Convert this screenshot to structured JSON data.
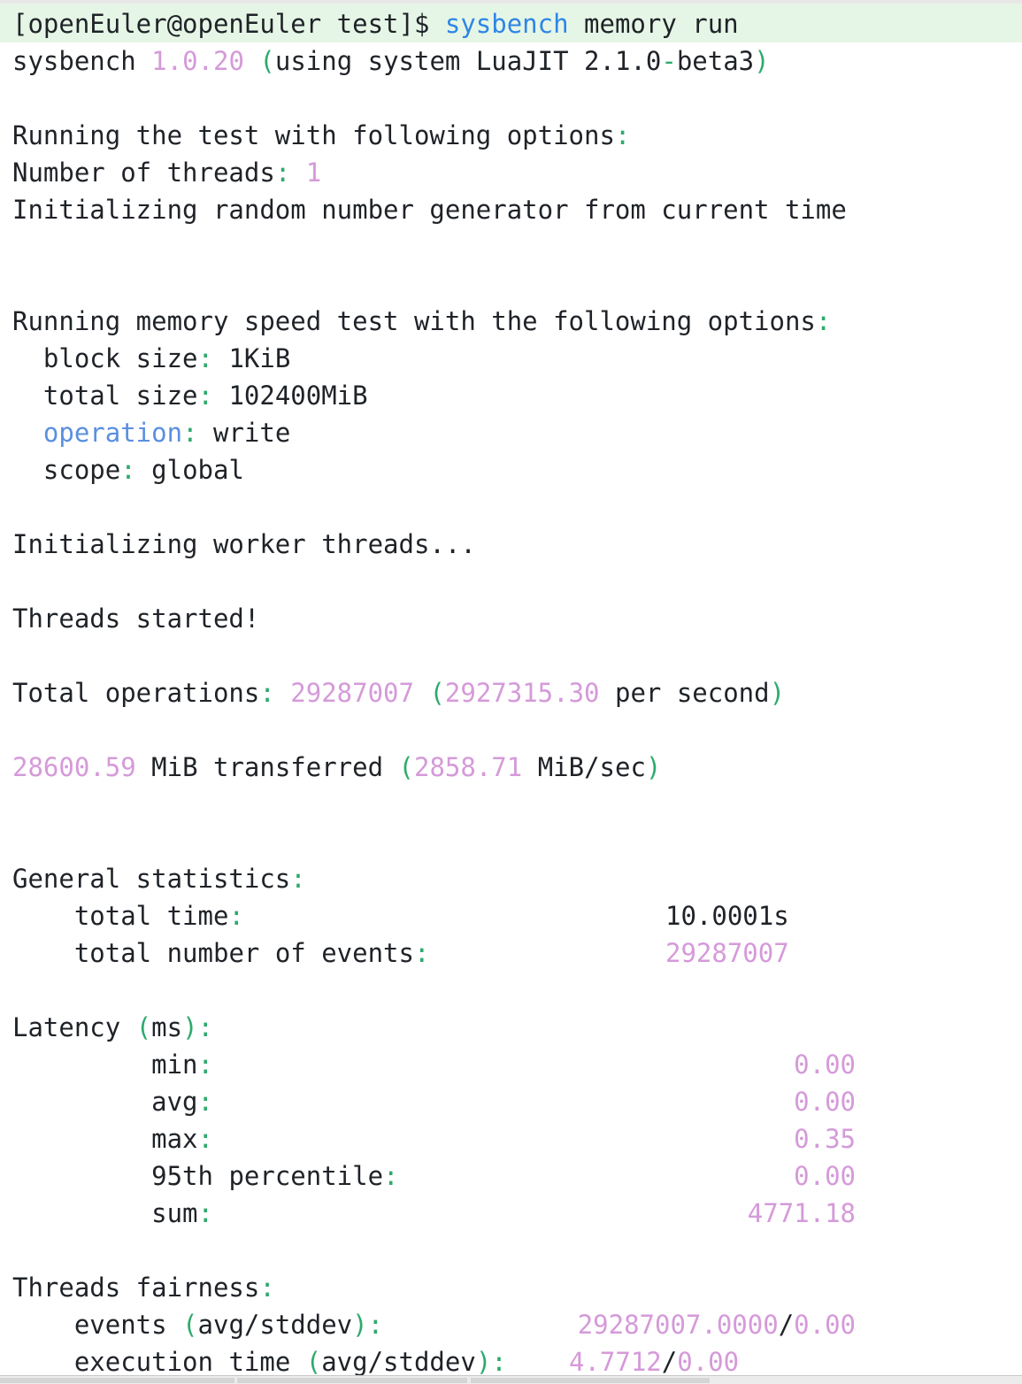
{
  "command": {
    "prompt": "[openEuler@openEuler test]$",
    "program": "sysbench",
    "args": "memory run"
  },
  "version_line": {
    "name": "sysbench",
    "version": "1.0.20",
    "paren_open": "(",
    "text": "using system LuaJIT 2.1.0",
    "dash": "-",
    "beta": "beta3",
    "paren_close": ")"
  },
  "options": {
    "heading": "Running the test with following options",
    "threads_label": "Number of threads",
    "threads_value": "1",
    "rng_line": "Initializing random number generator from current time"
  },
  "memory": {
    "heading": "Running memory speed test with the following options",
    "block_label": "block size",
    "block_value": "1KiB",
    "total_label": "total size",
    "total_value": "102400MiB",
    "operation_label": "operation",
    "operation_value": "write",
    "scope_label": "scope",
    "scope_value": "global"
  },
  "workers": {
    "init_line": "Initializing worker threads...",
    "started_line": "Threads started!"
  },
  "totals": {
    "ops_label": "Total operations",
    "ops_value": "29287007",
    "ops_rate": "2927315.30",
    "ops_rate_unit": "per second",
    "transferred_value": "28600.59",
    "transferred_text": "MiB transferred",
    "transferred_rate": "2858.71",
    "transferred_rate_unit": "MiB/sec"
  },
  "general": {
    "heading": "General statistics",
    "time_label": "total time",
    "time_value": "10.0001s",
    "events_label": "total number of events",
    "events_value": "29287007"
  },
  "latency": {
    "heading": "Latency",
    "unit": "ms",
    "min_label": "min",
    "min_value": "0.00",
    "avg_label": "avg",
    "avg_value": "0.00",
    "max_label": "max",
    "max_value": "0.35",
    "p95_label": "95th percentile",
    "p95_value": "0.00",
    "sum_label": "sum",
    "sum_value": "4771.18"
  },
  "fairness": {
    "heading": "Threads fairness",
    "events_label": "events",
    "events_paren": "avg/stddev",
    "events_avg": "29287007.0000",
    "events_std": "0.00",
    "exec_label": "execution time",
    "exec_paren": "avg/stddev",
    "exec_avg": "4.7712",
    "exec_std": "0.00"
  },
  "colors": {
    "punctuation": "#2eaa6e",
    "number": "#d59ad9",
    "command": "#2e86e6",
    "keyword": "#5a8fe0",
    "prompt_row_bg": "#e6f6e6"
  }
}
